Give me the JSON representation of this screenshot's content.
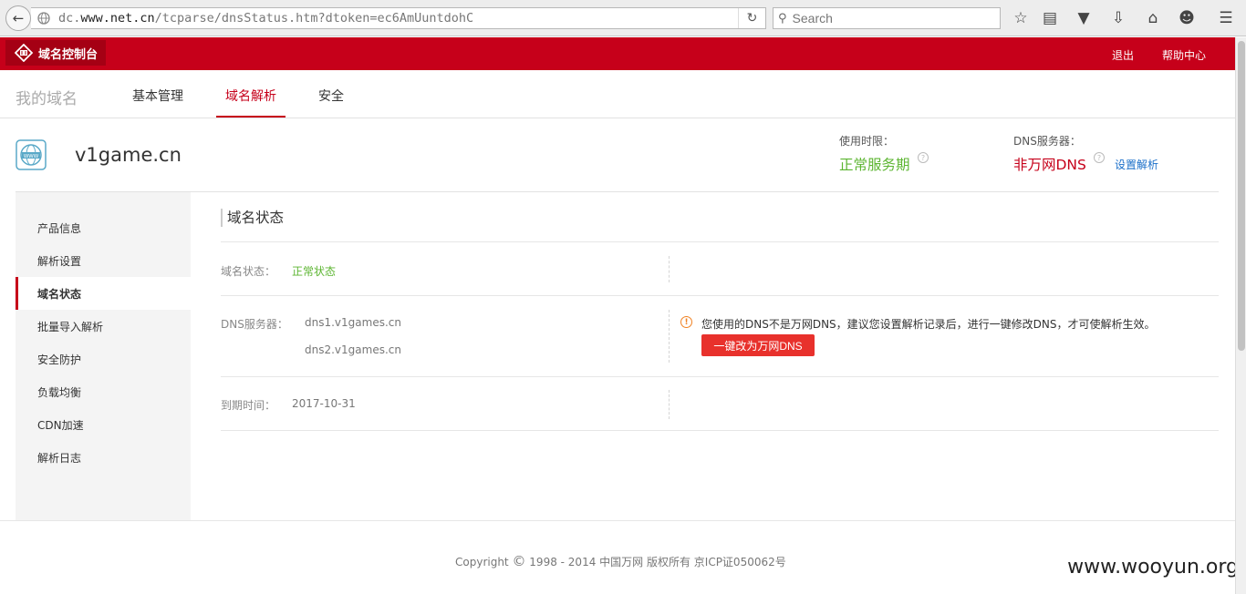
{
  "browser": {
    "url_prefix": "dc.",
    "url_host": "www.net.cn",
    "url_path": "/tcparse/dnsStatus.htm?dtoken=ec6AmUuntdohC",
    "search_placeholder": "Search"
  },
  "header": {
    "logo_text": "域名控制台",
    "logout": "退出",
    "help": "帮助中心"
  },
  "tabs": {
    "my_domain": "我的域名",
    "items": [
      "基本管理",
      "域名解析",
      "安全"
    ],
    "active_index": 1
  },
  "domain": {
    "name": "v1game.cn",
    "period_label": "使用时限：",
    "period_value": "正常服务期",
    "dns_label": "DNS服务器：",
    "dns_value": "非万网DNS",
    "set_link": "设置解析"
  },
  "sidebar": {
    "items": [
      "产品信息",
      "解析设置",
      "域名状态",
      "批量导入解析",
      "安全防护",
      "负载均衡",
      "CDN加速",
      "解析日志"
    ],
    "active_index": 2
  },
  "main": {
    "title": "域名状态",
    "status_label": "域名状态：",
    "status_value": "正常状态",
    "dns_label": "DNS服务器：",
    "dns1": "dns1.v1games.cn",
    "dns2": "dns2.v1games.cn",
    "warning": "您使用的DNS不是万网DNS，建议您设置解析记录后，进行一键修改DNS，才可使解析生效。",
    "switch_button": "一键改为万网DNS",
    "expire_label": "到期时间：",
    "expire_value": "2017-10-31"
  },
  "footer": {
    "copyright_pre": "Copyright",
    "copyright_post": "1998 - 2014 中国万网 版权所有 京ICP证050062号",
    "watermark": "www.wooyun.org"
  },
  "colors": {
    "brand_red": "#c6001a",
    "ok_green": "#5cb531",
    "link_blue": "#1a6fc9",
    "button_red": "#e8312c",
    "warning_orange": "#f08224"
  }
}
